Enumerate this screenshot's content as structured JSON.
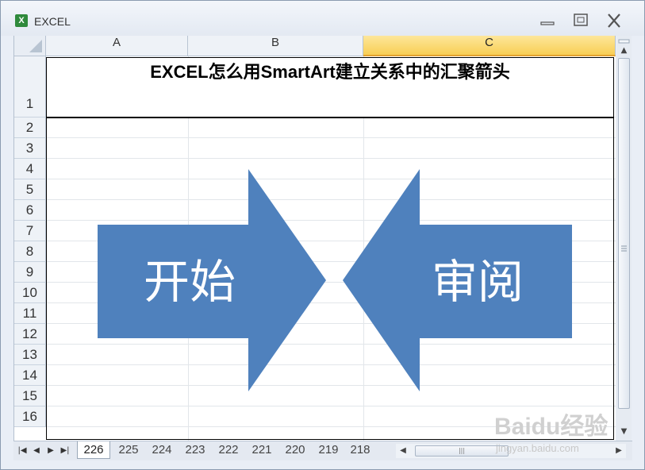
{
  "window": {
    "title": "EXCEL",
    "app_icon": "excel-icon",
    "controls": [
      "minimize-icon",
      "maximize-icon",
      "close-icon"
    ]
  },
  "columns": [
    {
      "label": "A",
      "selected": false
    },
    {
      "label": "B",
      "selected": false
    },
    {
      "label": "C",
      "selected": true
    }
  ],
  "rows": [
    "1",
    "2",
    "3",
    "4",
    "5",
    "6",
    "7",
    "8",
    "9",
    "10",
    "11",
    "12",
    "13",
    "14",
    "15",
    "16"
  ],
  "cell_title": "EXCEL怎么用SmartArt建立关系中的汇聚箭头",
  "smartart": {
    "left_arrow_text": "开始",
    "right_arrow_text": "审阅",
    "arrow_color": "#4f81bd",
    "text_color": "#ffffff"
  },
  "sheet_tabs": [
    "226",
    "225",
    "224",
    "223",
    "222",
    "221",
    "220",
    "219",
    "218"
  ],
  "active_tab": "226",
  "watermark": {
    "text": "Baidu经验",
    "url": "jingyan.baidu.com"
  },
  "colors": {
    "selected_header": "#f8cf55",
    "grid_line": "#e2e6ea",
    "header_bg": "#eef2f7"
  }
}
